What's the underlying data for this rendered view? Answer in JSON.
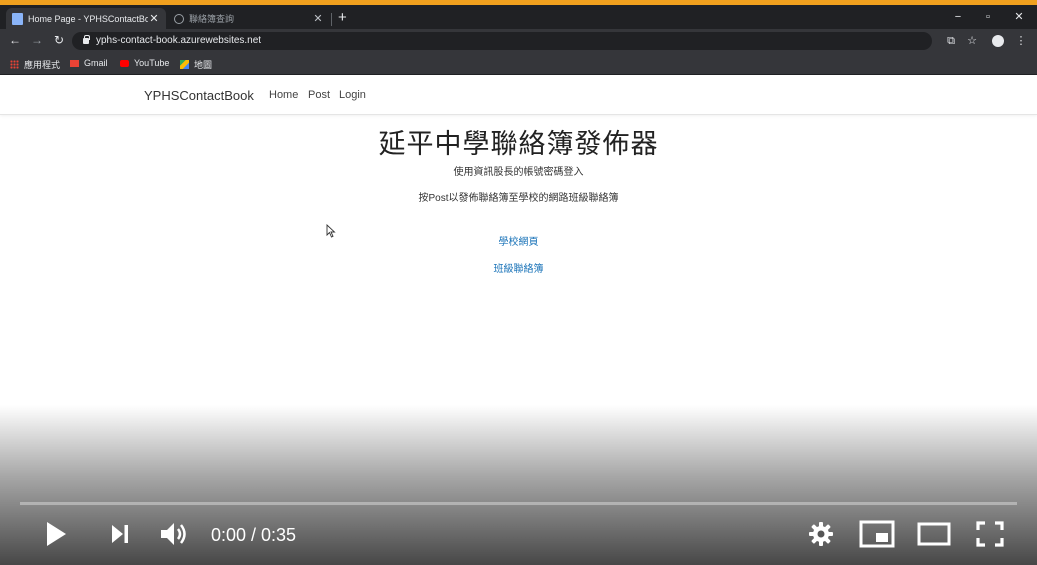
{
  "browser": {
    "tabs": [
      {
        "title": "Home Page - YPHSContactBoo",
        "active": true
      },
      {
        "title": "聯絡簿查詢",
        "active": false
      }
    ],
    "url": "yphs-contact-book.azurewebsites.net",
    "bookmarks": [
      {
        "label": "應用程式",
        "icon": "apps-grid-icon"
      },
      {
        "label": "Gmail",
        "icon": "gmail-icon"
      },
      {
        "label": "YouTube",
        "icon": "youtube-icon"
      },
      {
        "label": "地圖",
        "icon": "maps-icon"
      }
    ],
    "accent_color": "#f0a01e"
  },
  "site": {
    "brand": "YPHSContactBook",
    "nav": {
      "home": "Home",
      "post": "Post",
      "login": "Login"
    },
    "title": "延平中學聯絡簿發佈器",
    "subtitle": "使用資訊股長的帳號密碼登入",
    "instruction": "按Post以發佈聯絡簿至學校的網路班級聯絡簿",
    "links": {
      "school": "學校網頁",
      "contact_book": "班級聯絡簿"
    },
    "link_color": "#1a73b8"
  },
  "player": {
    "time": "0:00 / 0:35",
    "progress": 0.0,
    "controls": [
      "play-icon",
      "next-icon",
      "volume-icon",
      "settings-icon",
      "miniplayer-icon",
      "theater-icon",
      "fullscreen-icon"
    ]
  }
}
